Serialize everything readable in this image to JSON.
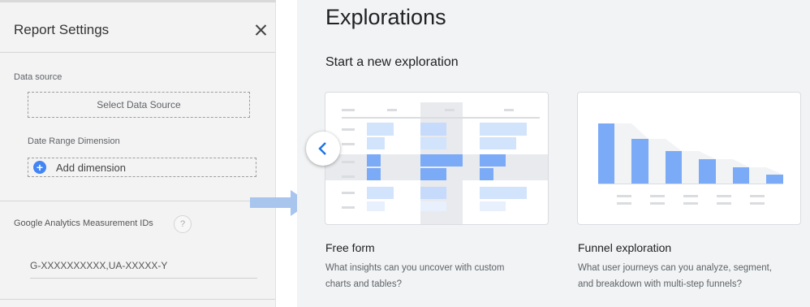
{
  "report_settings": {
    "title": "Report Settings",
    "close_icon": "close-icon",
    "data_source": {
      "label": "Data source",
      "button_label": "Select Data Source"
    },
    "date_range": {
      "label": "Date Range Dimension",
      "add_label": "Add dimension",
      "add_icon": "plus-circle-icon"
    },
    "measurement_ids": {
      "label": "Google Analytics Measurement IDs",
      "help_label": "?",
      "value": "G-XXXXXXXXXX,UA-XXXXX-Y"
    }
  },
  "transition_arrow": {
    "icon": "arrow-right-icon",
    "color": "#a8c5ee"
  },
  "explorations": {
    "heading": "Explorations",
    "subheading": "Start a new exploration",
    "prev_icon": "chevron-left-icon",
    "cards": [
      {
        "title": "Free form",
        "description_lines": [
          "What insights can you uncover with custom",
          "charts and tables?"
        ]
      },
      {
        "title": "Funnel exploration",
        "description_lines": [
          "What user journeys can you analyze, segment,",
          "and breakdown with multi-step funnels?"
        ]
      }
    ],
    "colors": {
      "blue": "#7baaf7",
      "light_blue": "#d2e3fc",
      "grey": "#e8eaed"
    }
  }
}
